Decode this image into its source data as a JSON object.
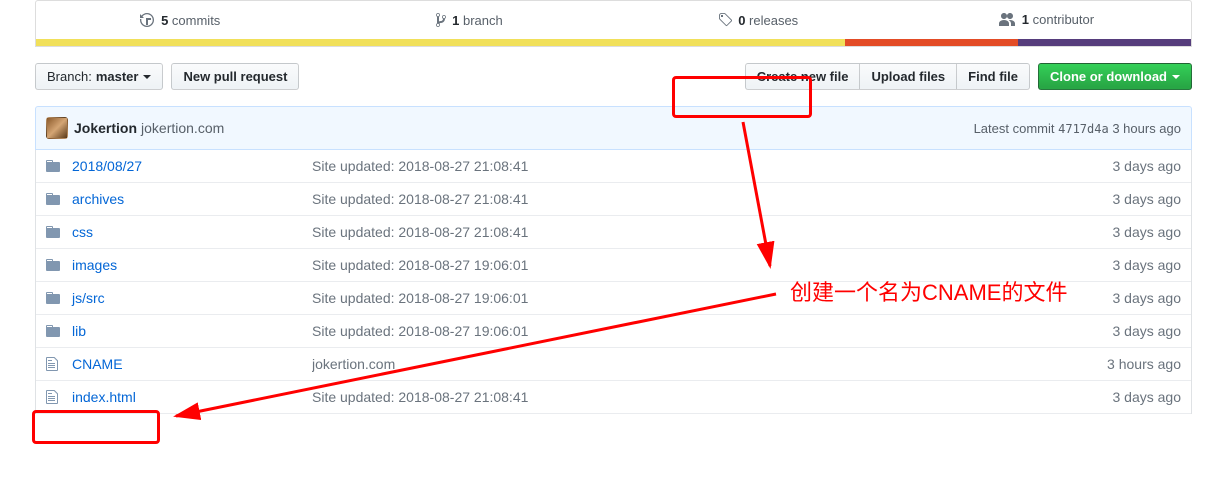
{
  "stats": {
    "commits": {
      "count": "5",
      "label": "commits"
    },
    "branch": {
      "count": "1",
      "label": "branch"
    },
    "releases": {
      "count": "0",
      "label": "releases"
    },
    "contributors": {
      "count": "1",
      "label": "contributor"
    }
  },
  "toolbar": {
    "branch_label": "Branch:",
    "branch_value": "master",
    "new_pr": "New pull request",
    "create_file": "Create new file",
    "upload": "Upload files",
    "find": "Find file",
    "clone": "Clone or download"
  },
  "commit": {
    "author": "Jokertion",
    "message": "jokertion.com",
    "latest_label": "Latest commit",
    "sha": "4717d4a",
    "time": "3 hours ago"
  },
  "files": [
    {
      "type": "dir",
      "path_parts": [
        "2018",
        "08",
        "27"
      ],
      "message": "Site updated: 2018-08-27 21:08:41",
      "age": "3 days ago"
    },
    {
      "type": "dir",
      "path_parts": [
        "archives"
      ],
      "message": "Site updated: 2018-08-27 21:08:41",
      "age": "3 days ago"
    },
    {
      "type": "dir",
      "path_parts": [
        "css"
      ],
      "message": "Site updated: 2018-08-27 21:08:41",
      "age": "3 days ago"
    },
    {
      "type": "dir",
      "path_parts": [
        "images"
      ],
      "message": "Site updated: 2018-08-27 19:06:01",
      "age": "3 days ago"
    },
    {
      "type": "dir",
      "path_parts": [
        "js",
        "src"
      ],
      "message": "Site updated: 2018-08-27 19:06:01",
      "age": "3 days ago"
    },
    {
      "type": "dir",
      "path_parts": [
        "lib"
      ],
      "message": "Site updated: 2018-08-27 19:06:01",
      "age": "3 days ago"
    },
    {
      "type": "file",
      "path_parts": [
        "CNAME"
      ],
      "message": "jokertion.com",
      "age": "3 hours ago"
    },
    {
      "type": "file",
      "path_parts": [
        "index.html"
      ],
      "message": "Site updated: 2018-08-27 21:08:41",
      "age": "3 days ago"
    }
  ],
  "annotation": {
    "text": "创建一个名为CNAME的文件"
  }
}
